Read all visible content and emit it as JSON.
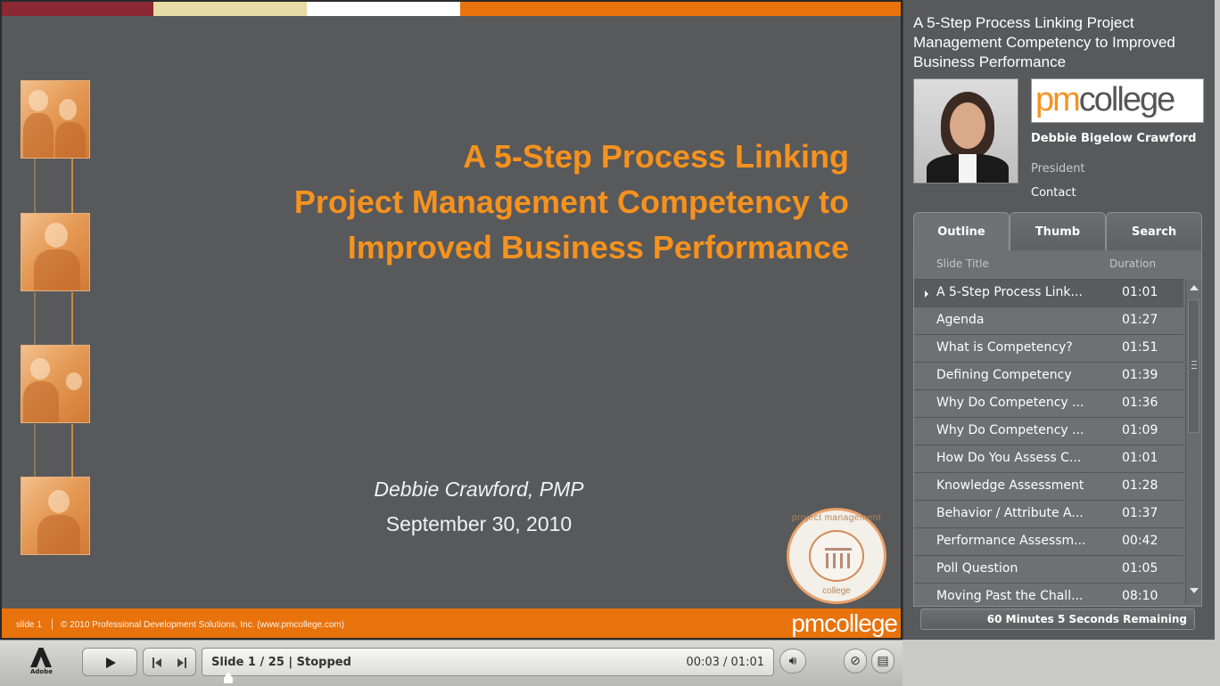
{
  "slide": {
    "title_lines": [
      "A 5-Step Process Linking",
      "Project Management Competency to",
      "Improved Business Performance"
    ],
    "author": "Debbie Crawford, PMP",
    "date": "September 30, 2010",
    "seal_top": "project management",
    "seal_bottom": "college",
    "footer_slide": "slide 1",
    "footer_copyright": "© 2010 Professional Development Solutions, Inc. (www.pmcollege.com)",
    "footer_logo": "pmcollege"
  },
  "colors": {
    "accent_orange": "#f6921e",
    "footer_orange": "#e8720c",
    "slide_background": "#58595b",
    "topbar": [
      "#8c2734",
      "#e8dca6",
      "#ffffff",
      "#e8720c"
    ]
  },
  "player": {
    "brand": "Adobe",
    "status": "Slide 1 / 25 | Stopped",
    "time": "00:03 / 01:01",
    "icons": {
      "play": "play-icon",
      "prev": "skip-previous-icon",
      "next": "skip-next-icon",
      "volume": "speaker-icon",
      "attachments": "paperclip-icon",
      "notes": "notes-icon"
    }
  },
  "sidebar": {
    "title": "A 5-Step Process Linking Project Management Competency to Improved Business Performance",
    "logo_prefix": "pm",
    "logo_suffix": "college",
    "speaker_name": "Debbie Bigelow Crawford",
    "speaker_role": "President",
    "contact_label": "Contact",
    "tabs": [
      "Outline",
      "Thumb",
      "Search"
    ],
    "columns": {
      "title": "Slide Title",
      "duration": "Duration"
    },
    "slides": [
      {
        "title": "A 5-Step Process Link...",
        "duration": "01:01"
      },
      {
        "title": "Agenda",
        "duration": "01:27"
      },
      {
        "title": "What is Competency?",
        "duration": "01:51"
      },
      {
        "title": "Defining Competency",
        "duration": "01:39"
      },
      {
        "title": "Why Do Competency ...",
        "duration": "01:36"
      },
      {
        "title": "Why Do Competency ...",
        "duration": "01:09"
      },
      {
        "title": "How Do You Assess C...",
        "duration": "01:01"
      },
      {
        "title": "Knowledge Assessment",
        "duration": "01:28"
      },
      {
        "title": "Behavior / Attribute A...",
        "duration": "01:37"
      },
      {
        "title": "Performance Assessm...",
        "duration": "00:42"
      },
      {
        "title": "Poll Question",
        "duration": "01:05"
      },
      {
        "title": "Moving Past the Chall...",
        "duration": "08:10"
      }
    ],
    "remaining": "60 Minutes 5 Seconds Remaining"
  }
}
